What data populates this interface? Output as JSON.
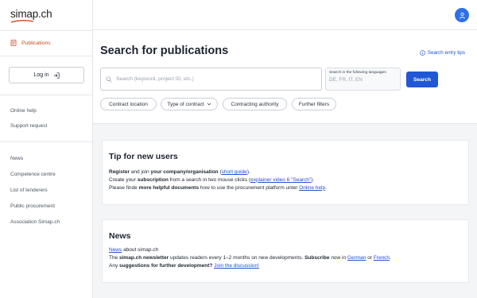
{
  "brand": {
    "logo_text": "simap.ch",
    "accent": "#c24a1b",
    "primary": "#1f57d6"
  },
  "sidebar": {
    "active_item": "Publications",
    "login_label": "Log in",
    "help_links": [
      "Online help",
      "Support request"
    ],
    "info_links": [
      "News",
      "Competence centre",
      "List of tenderers",
      "Public procurement",
      "Association Simap.ch"
    ]
  },
  "search": {
    "title": "Search for publications",
    "tips_label": "Search entry tips",
    "placeholder": "Search (keyword, project ID, etc.)",
    "lang_label": "Search in the following languages",
    "lang_value": "DE, FR, IT, EN",
    "button": "Search",
    "filters": [
      "Contract location",
      "Type of contract",
      "Contracting authority",
      "Further filters"
    ]
  },
  "tip_card": {
    "title": "Tip for new users",
    "l1_register": "Register",
    "l1_mid": " and join ",
    "l1_org": "your company/organisation",
    "l1_open": " (",
    "l1_link": "short guide",
    "l1_close": ").",
    "l2_a": "Create your ",
    "l2_b": "subscription",
    "l2_c": " from a search in two mouse clicks (",
    "l2_link": "explainer video 6 \"Search\"",
    "l2_d": ").",
    "l3_a": "Please finde ",
    "l3_b": "more helpful documents",
    "l3_c": " how to use the procurement platform unter ",
    "l3_link": "Online help",
    "l3_d": "."
  },
  "news_card": {
    "title": "News",
    "l1_link": "News",
    "l1_rest": " about simap.ch",
    "l2_a": "The ",
    "l2_b": "simap.ch newsletter",
    "l2_c": " updates readers every 1–2 months on new developments. ",
    "l2_d": "Subscribe",
    "l2_e": " now in ",
    "l2_link1": "German",
    "l2_f": " or ",
    "l2_link2": "French",
    "l2_g": ".",
    "l3_a": "Any ",
    "l3_b": "suggestions for further development?",
    "l3_c": " ",
    "l3_link": "Join the discussion!"
  }
}
